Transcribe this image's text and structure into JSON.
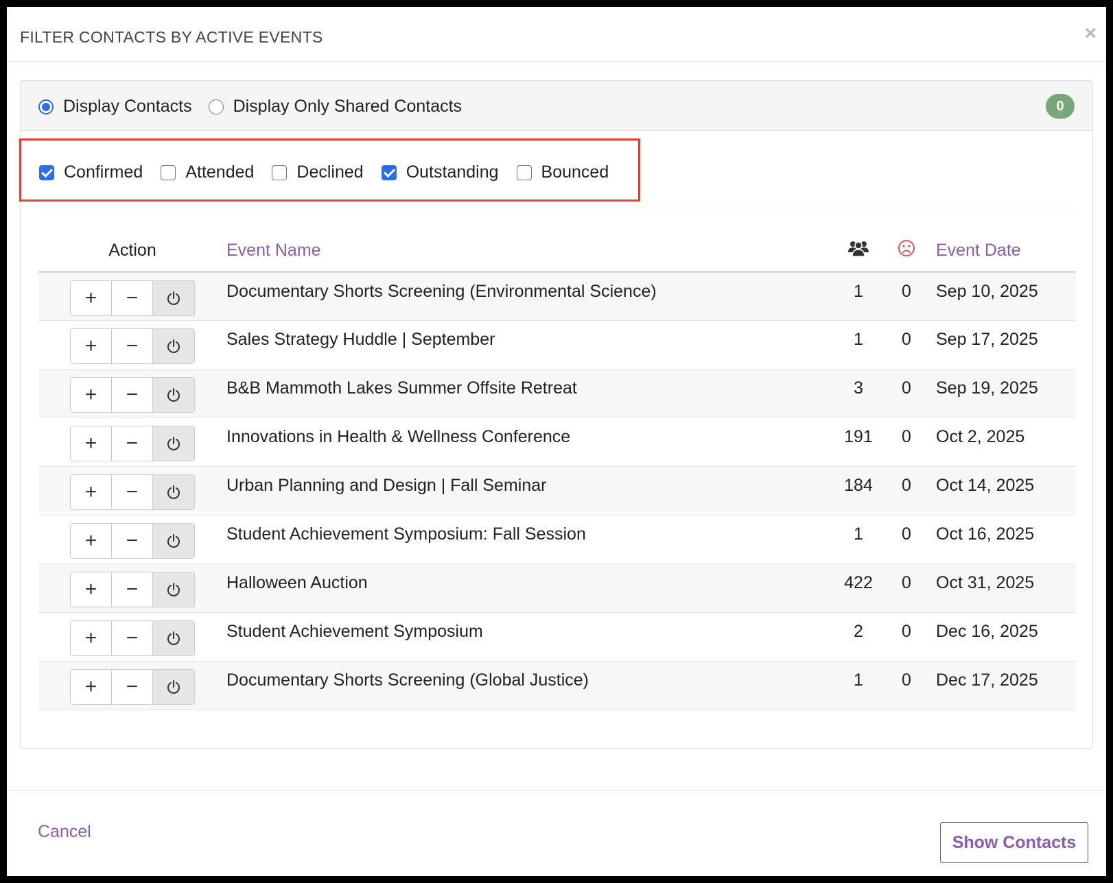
{
  "modal": {
    "title": "FILTER CONTACTS BY ACTIVE EVENTS",
    "close_glyph": "×"
  },
  "display_mode": {
    "options": [
      {
        "label": "Display Contacts",
        "checked": true
      },
      {
        "label": "Display Only Shared Contacts",
        "checked": false
      }
    ],
    "badge_count": "0",
    "badge_color": "#7aa77a"
  },
  "statuses": [
    {
      "label": "Confirmed",
      "checked": true
    },
    {
      "label": "Attended",
      "checked": false
    },
    {
      "label": "Declined",
      "checked": false
    },
    {
      "label": "Outstanding",
      "checked": true
    },
    {
      "label": "Bounced",
      "checked": false
    }
  ],
  "table": {
    "headers": {
      "action": "Action",
      "event_name": "Event Name",
      "count_icon": "users-icon",
      "bounce_icon": "frown-icon",
      "event_date": "Event Date"
    },
    "action_buttons": {
      "add": "+",
      "remove": "−",
      "power_icon": "power-icon"
    },
    "rows": [
      {
        "name": "Documentary Shorts Screening (Environmental Science)",
        "count": "1",
        "bounced": "0",
        "date": "Sep 10, 2025"
      },
      {
        "name": "Sales Strategy Huddle | September",
        "count": "1",
        "bounced": "0",
        "date": "Sep 17, 2025"
      },
      {
        "name": "B&B Mammoth Lakes Summer Offsite Retreat",
        "count": "3",
        "bounced": "0",
        "date": "Sep 19, 2025"
      },
      {
        "name": "Innovations in Health & Wellness Conference",
        "count": "191",
        "bounced": "0",
        "date": "Oct 2, 2025"
      },
      {
        "name": "Urban Planning and Design | Fall Seminar",
        "count": "184",
        "bounced": "0",
        "date": "Oct 14, 2025"
      },
      {
        "name": "Student Achievement Symposium: Fall Session",
        "count": "1",
        "bounced": "0",
        "date": "Oct 16, 2025"
      },
      {
        "name": "Halloween Auction",
        "count": "422",
        "bounced": "0",
        "date": "Oct 31, 2025"
      },
      {
        "name": "Student Achievement Symposium",
        "count": "2",
        "bounced": "0",
        "date": "Dec 16, 2025"
      },
      {
        "name": "Documentary Shorts Screening (Global Justice)",
        "count": "1",
        "bounced": "0",
        "date": "Dec 17, 2025"
      }
    ]
  },
  "footer": {
    "cancel_label": "Cancel",
    "show_label": "Show Contacts"
  },
  "colors": {
    "accent_purple": "#8a5ea8",
    "highlight_red": "#e3412d",
    "check_blue": "#2a6ee8",
    "bounce_icon_red": "#d9534f"
  }
}
